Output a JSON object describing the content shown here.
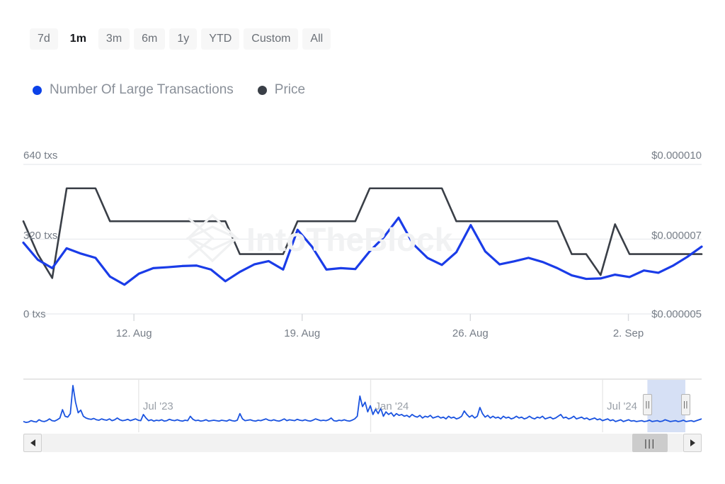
{
  "range_selector": {
    "buttons": [
      {
        "label": "7d",
        "selected": false
      },
      {
        "label": "1m",
        "selected": true
      },
      {
        "label": "3m",
        "selected": false
      },
      {
        "label": "6m",
        "selected": false
      },
      {
        "label": "1y",
        "selected": false
      },
      {
        "label": "YTD",
        "selected": false
      },
      {
        "label": "Custom",
        "selected": false
      },
      {
        "label": "All",
        "selected": false
      }
    ]
  },
  "legend": {
    "items": [
      {
        "label": "Number Of Large Transactions",
        "color": "#0b41e8",
        "icon": "circle-marker-icon"
      },
      {
        "label": "Price",
        "color": "#3a3f47",
        "icon": "circle-marker-icon"
      }
    ]
  },
  "watermark": {
    "text": "IntoTheBlock",
    "color": "#f1f2f3",
    "logo": "intotheblock-logo-icon"
  },
  "navigator": {
    "tick_labels": [
      "Jul '23",
      "Jan '24",
      "Jul '24"
    ],
    "selection": {
      "start_pct": 92.0,
      "end_pct": 97.6
    },
    "series_color": "#1a53e0",
    "selection_fill": "#cfdbf3",
    "scrollbar": {
      "left_button": "scroll-left-icon",
      "right_button": "scroll-right-icon",
      "thumb_grip": "|||",
      "handle_grip": "||"
    }
  },
  "chart_data": {
    "type": "line",
    "title": "",
    "xlabel": "",
    "grid": true,
    "legend_position": "top-left",
    "x_tick_labels": [
      "12. Aug",
      "19. Aug",
      "26. Aug",
      "2. Sep"
    ],
    "x_tick_positions_pct": [
      16.3,
      41.1,
      65.9,
      89.2
    ],
    "axes": {
      "left": {
        "label": "Number Of Large Transactions",
        "unit": "txs",
        "tick_labels": [
          "640 txs",
          "320 txs",
          "0 txs"
        ],
        "ticks": [
          640,
          320,
          0
        ],
        "min": 0,
        "max": 640
      },
      "right": {
        "label": "Price",
        "unit": "USD",
        "tick_labels": [
          "$0.000010",
          "$0.000007",
          "$0.000005"
        ],
        "ticks": [
          1e-05,
          7e-06,
          5e-06
        ],
        "min": 5e-06,
        "max": 1e-05
      }
    },
    "series": [
      {
        "name": "Number Of Large Transactions",
        "color": "#1a3ce8",
        "axis": "left",
        "unit": "txs",
        "values": [
          305,
          232,
          196,
          281,
          258,
          240,
          160,
          125,
          172,
          196,
          200,
          205,
          207,
          190,
          140,
          180,
          212,
          226,
          190,
          360,
          288,
          190,
          196,
          192,
          268,
          330,
          412,
          300,
          240,
          210,
          264,
          380,
          268,
          212,
          225,
          240,
          222,
          196,
          165,
          150,
          152,
          168,
          158,
          186,
          176,
          206,
          244,
          288
        ]
      },
      {
        "name": "Price",
        "color": "#3a3f47",
        "axis": "right",
        "unit": "USD",
        "values": [
          8.1e-06,
          7e-06,
          6.2e-06,
          9.2e-06,
          9.2e-06,
          9.2e-06,
          8.1e-06,
          8.1e-06,
          8.1e-06,
          8.1e-06,
          8.1e-06,
          8.1e-06,
          8.1e-06,
          8.1e-06,
          8.1e-06,
          7e-06,
          7e-06,
          7e-06,
          7e-06,
          8.1e-06,
          8.1e-06,
          8.1e-06,
          8.1e-06,
          8.1e-06,
          9.2e-06,
          9.2e-06,
          9.2e-06,
          9.2e-06,
          9.2e-06,
          9.2e-06,
          8.1e-06,
          8.1e-06,
          8.1e-06,
          8.1e-06,
          8.1e-06,
          8.1e-06,
          8.1e-06,
          8.1e-06,
          7e-06,
          7e-06,
          6.3e-06,
          8e-06,
          7e-06,
          7e-06,
          7e-06,
          7e-06,
          7e-06,
          7e-06
        ]
      }
    ],
    "navigator_series": {
      "name": "Number Of Large Transactions",
      "color": "#1a53e0",
      "values": [
        18,
        16,
        17,
        20,
        18,
        17,
        22,
        19,
        18,
        20,
        24,
        20,
        19,
        22,
        26,
        45,
        30,
        28,
        36,
        100,
        62,
        38,
        44,
        30,
        26,
        24,
        23,
        25,
        22,
        21,
        24,
        22,
        21,
        24,
        20,
        22,
        26,
        22,
        20,
        21,
        23,
        20,
        22,
        24,
        21,
        20,
        34,
        26,
        20,
        22,
        19,
        21,
        20,
        22,
        19,
        20,
        23,
        21,
        20,
        22,
        20,
        19,
        21,
        20,
        30,
        23,
        20,
        21,
        19,
        20,
        22,
        19,
        20,
        21,
        20,
        19,
        21,
        20,
        19,
        22,
        20,
        19,
        21,
        36,
        24,
        20,
        21,
        22,
        20,
        19,
        21,
        20,
        22,
        24,
        21,
        20,
        22,
        20,
        19,
        21,
        24,
        20,
        22,
        21,
        20,
        23,
        21,
        20,
        22,
        20,
        19,
        21,
        24,
        22,
        20,
        21,
        20,
        22,
        26,
        20,
        19,
        21,
        20,
        22,
        20,
        19,
        21,
        24,
        30,
        76,
        52,
        62,
        40,
        54,
        34,
        46,
        36,
        48,
        30,
        40,
        34,
        38,
        30,
        36,
        32,
        34,
        30,
        32,
        28,
        34,
        30,
        28,
        32,
        26,
        30,
        28,
        32,
        26,
        28,
        30,
        26,
        28,
        24,
        30,
        26,
        28,
        24,
        26,
        30,
        42,
        34,
        28,
        32,
        26,
        30,
        50,
        36,
        28,
        32,
        26,
        30,
        26,
        28,
        24,
        30,
        26,
        28,
        24,
        26,
        30,
        26,
        28,
        24,
        26,
        30,
        26,
        24,
        28,
        26,
        30,
        24,
        26,
        28,
        24,
        26,
        30,
        34,
        26,
        28,
        24,
        26,
        30,
        24,
        26,
        28,
        24,
        26,
        22,
        24,
        26,
        22,
        24,
        20,
        22,
        24,
        20,
        22,
        18,
        20,
        22,
        18,
        20,
        22,
        19,
        20,
        18,
        19,
        20,
        18,
        19,
        21,
        18,
        19,
        20,
        18,
        19,
        22,
        20,
        18,
        19,
        20,
        18,
        19,
        21,
        18,
        19,
        20,
        18,
        20,
        22,
        24
      ]
    }
  }
}
